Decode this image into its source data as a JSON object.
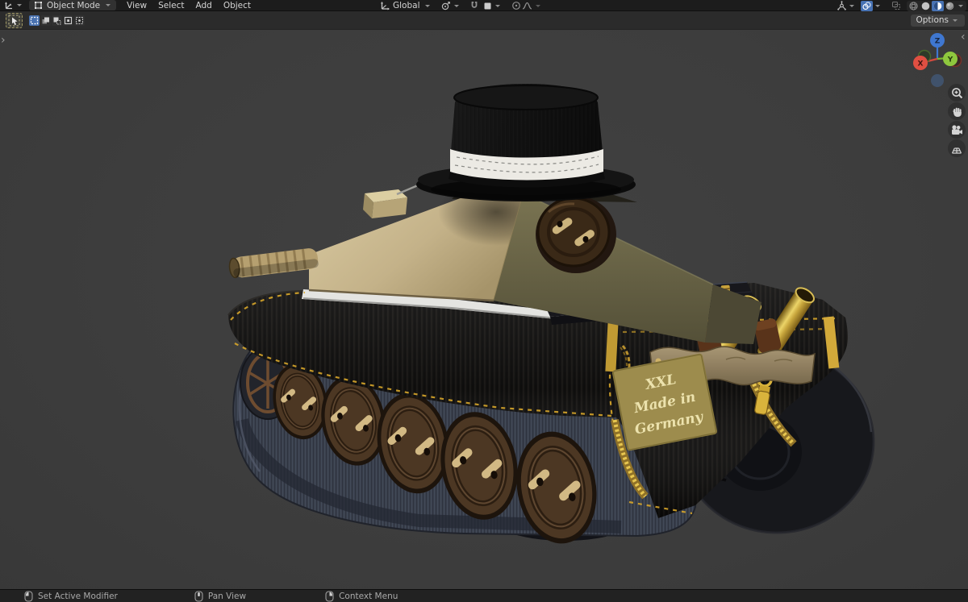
{
  "topbar": {
    "editor_icon": "3d-viewport-editor-icon",
    "mode": {
      "label": "Object Mode",
      "icon": "object-mode-icon"
    },
    "menus": [
      {
        "label": "View"
      },
      {
        "label": "Select"
      },
      {
        "label": "Add"
      },
      {
        "label": "Object"
      }
    ],
    "transform": {
      "orientation_label": "Global",
      "orientation_icon": "transform-orientation-icon"
    },
    "icons": [
      "pivot-point-icon",
      "snap-magnet-icon",
      "snap-target-icon",
      "proportional-editing-icon",
      "falloff-curve-icon",
      "show-gizmo-icon",
      "show-overlays-icon",
      "toggle-xray-icon",
      "shading-wireframe-icon",
      "shading-solid-icon",
      "shading-material-icon",
      "shading-rendered-icon"
    ]
  },
  "toolbar": {
    "active_tool": "select-box-tool",
    "select_modes": [
      "set",
      "extend",
      "subtract",
      "invert",
      "intersect"
    ],
    "options_label": "Options"
  },
  "viewport": {
    "gizmo": {
      "x": "X",
      "y": "Y",
      "z": "Z"
    },
    "nav_tools": [
      "zoom",
      "move-view",
      "camera-view",
      "toggle-perspective"
    ],
    "scene": {
      "description": "plush toy tank with black knitted top hat, button turret, leather button wheels, brass exhausts",
      "label_lines": {
        "l1": "XXL",
        "l2": "Made in",
        "l3": "Germany"
      }
    }
  },
  "statusbar": {
    "hints": [
      {
        "button": "left-mouse",
        "label": "Set Active Modifier"
      },
      {
        "button": "middle-mouse",
        "label": "Pan View"
      },
      {
        "button": "right-mouse",
        "label": "Context Menu"
      }
    ]
  },
  "colors": {
    "accent_blue": "#4772b3",
    "stitch_gold": "#d7a62b",
    "hull_black": "#0d0c0b",
    "track_blue": "#3d4350",
    "turret_tan": "#cfc09a",
    "turret_olive": "#6b6749",
    "label_plate": "#b3a058",
    "viewport_bg": "#3c3c3c"
  }
}
